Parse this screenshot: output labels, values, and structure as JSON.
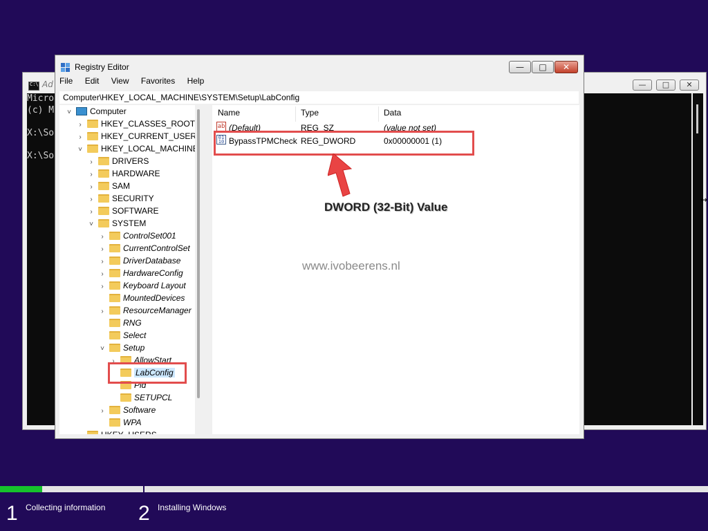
{
  "console": {
    "title": "Ad",
    "lines": [
      "Micro",
      "(c) M",
      "",
      "X:\\So",
      "",
      "X:\\So"
    ]
  },
  "regedit": {
    "title": "Registry Editor",
    "buttons": {
      "minimize": "—",
      "maximize": "□",
      "close": "✕"
    },
    "menu": [
      "File",
      "Edit",
      "View",
      "Favorites",
      "Help"
    ],
    "address": "Computer\\HKEY_LOCAL_MACHINE\\SYSTEM\\Setup\\LabConfig",
    "tree": [
      {
        "label": "Computer",
        "depth": 0,
        "chevron": "˅",
        "icon": "computer-icon"
      },
      {
        "label": "HKEY_CLASSES_ROOT",
        "depth": 1,
        "chevron": "›",
        "icon": "folder-icon"
      },
      {
        "label": "HKEY_CURRENT_USER",
        "depth": 1,
        "chevron": "›",
        "icon": "folder-icon"
      },
      {
        "label": "HKEY_LOCAL_MACHINE",
        "depth": 1,
        "chevron": "˅",
        "icon": "folder-icon"
      },
      {
        "label": "DRIVERS",
        "depth": 2,
        "chevron": "›",
        "icon": "folder-icon"
      },
      {
        "label": "HARDWARE",
        "depth": 2,
        "chevron": "›",
        "icon": "folder-icon"
      },
      {
        "label": "SAM",
        "depth": 2,
        "chevron": "›",
        "icon": "folder-icon"
      },
      {
        "label": "SECURITY",
        "depth": 2,
        "chevron": "›",
        "icon": "folder-icon"
      },
      {
        "label": "SOFTWARE",
        "depth": 2,
        "chevron": "›",
        "icon": "folder-icon"
      },
      {
        "label": "SYSTEM",
        "depth": 2,
        "chevron": "˅",
        "icon": "folder-icon"
      },
      {
        "label": "ControlSet001",
        "depth": 3,
        "chevron": "›",
        "icon": "folder-icon"
      },
      {
        "label": "CurrentControlSet",
        "depth": 3,
        "chevron": "›",
        "icon": "folder-icon"
      },
      {
        "label": "DriverDatabase",
        "depth": 3,
        "chevron": "›",
        "icon": "folder-icon"
      },
      {
        "label": "HardwareConfig",
        "depth": 3,
        "chevron": "›",
        "icon": "folder-icon"
      },
      {
        "label": "Keyboard Layout",
        "depth": 3,
        "chevron": "›",
        "icon": "folder-icon"
      },
      {
        "label": "MountedDevices",
        "depth": 3,
        "chevron": "",
        "icon": "folder-icon"
      },
      {
        "label": "ResourceManager",
        "depth": 3,
        "chevron": "›",
        "icon": "folder-icon"
      },
      {
        "label": "RNG",
        "depth": 3,
        "chevron": "",
        "icon": "folder-icon"
      },
      {
        "label": "Select",
        "depth": 3,
        "chevron": "",
        "icon": "folder-icon"
      },
      {
        "label": "Setup",
        "depth": 3,
        "chevron": "˅",
        "icon": "folder-icon"
      },
      {
        "label": "AllowStart",
        "depth": 4,
        "chevron": "›",
        "icon": "folder-icon"
      },
      {
        "label": "LabConfig",
        "depth": 4,
        "chevron": "",
        "icon": "folder-icon",
        "selected": true
      },
      {
        "label": "Pid",
        "depth": 4,
        "chevron": "",
        "icon": "folder-icon"
      },
      {
        "label": "SETUPCL",
        "depth": 4,
        "chevron": "",
        "icon": "folder-icon"
      },
      {
        "label": "Software",
        "depth": 3,
        "chevron": "›",
        "icon": "folder-icon"
      },
      {
        "label": "WPA",
        "depth": 3,
        "chevron": "",
        "icon": "folder-icon"
      },
      {
        "label": "HKEY_USERS",
        "depth": 1,
        "chevron": "›",
        "icon": "folder-icon"
      }
    ],
    "columns": {
      "name": "Name",
      "type": "Type",
      "data": "Data"
    },
    "values": [
      {
        "name": "(Default)",
        "type": "REG_SZ",
        "data": "(value not set)",
        "icon": "string-value-icon"
      },
      {
        "name": "BypassTPMCheck",
        "type": "REG_DWORD",
        "data": "0x00000001 (1)",
        "icon": "dword-value-icon"
      }
    ]
  },
  "annotation": {
    "caption": "DWORD (32-Bit) Value",
    "watermark": "www.ivobeerens.nl",
    "color": "#e24d4d"
  },
  "setup": {
    "progress": 0.06,
    "steps": [
      {
        "number": "1",
        "label": "Collecting information"
      },
      {
        "number": "2",
        "label": "Installing Windows"
      }
    ],
    "accent": "#16c22c",
    "background": "#210a58"
  }
}
